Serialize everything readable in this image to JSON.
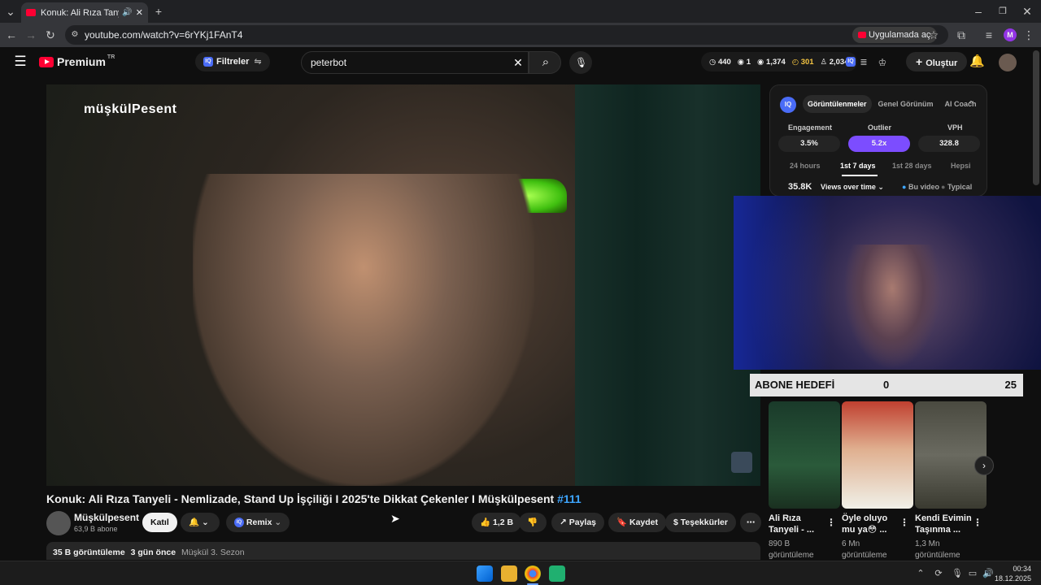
{
  "browser": {
    "tab_title": "Konuk: Ali Rıza Tanyeli - Ne",
    "url": "youtube.com/watch?v=6rYKj1FAnT4",
    "open_in_app": "Uygulamada aç",
    "profile_initial": "M"
  },
  "header": {
    "logo": "Premium",
    "region": "TR",
    "filters_label": "Filtreler",
    "search_query": "peterbot",
    "stats": [
      "440",
      "1",
      "1,374",
      "301",
      "2,034"
    ],
    "create_label": "Oluştur"
  },
  "video": {
    "channel_watermark": "müşkülPesent",
    "title": "Konuk: Ali Rıza Tanyeli - Nemlizade, Stand Up İşçiliği I 2025'te Dikkat Çekenler I Müşkülpesent",
    "hashtag": "#111",
    "channel_name": "Müşkülpesent",
    "subscribers": "63,9 B abone",
    "join_label": "Katıl",
    "remix_label": "Remix",
    "likes": "1,2 B",
    "share_label": "Paylaş",
    "save_label": "Kaydet",
    "thanks_label": "Teşekkürler",
    "views": "35 B görüntüleme",
    "posted": "3 gün önce",
    "series": "Müşkül 3. Sezon"
  },
  "panel": {
    "tabs": [
      "Görüntülenmeler",
      "Genel Görünüm",
      "AI Coach"
    ],
    "metrics": [
      {
        "label": "Engagement",
        "value": "3.5%"
      },
      {
        "label": "Outlier",
        "value": "5.2x"
      },
      {
        "label": "VPH",
        "value": "328.8"
      }
    ],
    "ranges": [
      "24 hours",
      "1st 7 days",
      "1st 28 days",
      "Hepsi"
    ],
    "views_total": "35.8K",
    "views_mode": "Views over time",
    "legend": [
      "Bu video",
      "Typical"
    ]
  },
  "overlay": {
    "goal_label": "ABONE HEDEFİ",
    "goal_current": "0",
    "goal_target": "25"
  },
  "recommendations": [
    {
      "title": "Ali Rıza Tanyeli - ...",
      "views": "890 B",
      "views_label": "görüntüleme"
    },
    {
      "title": "Öyle oluyo mu ya😳 ...",
      "views": "6 Mn",
      "views_label": "görüntüleme"
    },
    {
      "title": "Kendi Evimin Taşınma ...",
      "views": "1,3 Mn",
      "views_label": "görüntüleme"
    }
  ],
  "taskbar": {
    "time": "00:34",
    "date": "18.12.2025"
  },
  "colors": {
    "accent": "#7c4dff",
    "youtube_red": "#ff0033",
    "link": "#3ea6ff"
  }
}
